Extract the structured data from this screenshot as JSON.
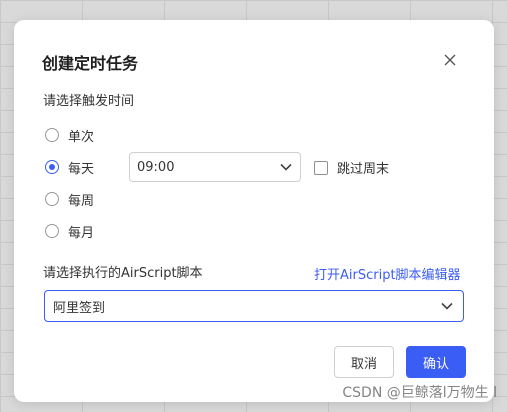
{
  "dialog": {
    "title": "创建定时任务",
    "trigger_label": "请选择触发时间",
    "radio_options": [
      "单次",
      "每天",
      "每周",
      "每月"
    ],
    "selected_option": "每天",
    "time_value": "09:00",
    "skip_weekend_label": "跳过周末",
    "script_label": "请选择执行的AirScript脚本",
    "open_editor_link": "打开AirScript脚本编辑器",
    "script_value": "阿里签到",
    "cancel_label": "取消",
    "confirm_label": "确认"
  },
  "watermark": "CSDN @巨鲸落l万物生 l",
  "colors": {
    "accent": "#3a5df6",
    "text": "#333333"
  }
}
